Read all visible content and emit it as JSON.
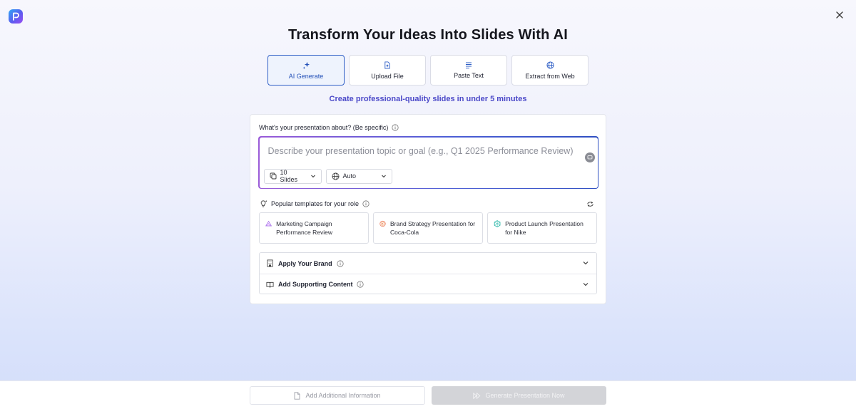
{
  "header": {
    "title": "Transform Your Ideas Into Slides With AI"
  },
  "tabs": [
    {
      "label": "AI Generate",
      "icon": "sparkle-icon",
      "active": true
    },
    {
      "label": "Upload File",
      "icon": "file-upload-icon",
      "active": false
    },
    {
      "label": "Paste Text",
      "icon": "text-lines-icon",
      "active": false
    },
    {
      "label": "Extract from Web",
      "icon": "globe-icon",
      "active": false
    }
  ],
  "tagline": "Create professional-quality slides in under 5 minutes",
  "prompt": {
    "label": "What's your presentation about? (Be specific)",
    "placeholder": "Describe your presentation topic or goal (e.g., Q1 2025 Performance Review)",
    "value": "",
    "slides_select": "10 Slides",
    "language_select": "Auto"
  },
  "templates": {
    "header": "Popular templates for your role",
    "items": [
      {
        "label": "Marketing Campaign Performance Review",
        "icon": "triangle-mountain-icon",
        "color": "#9b5de5"
      },
      {
        "label": "Brand Strategy Presentation for Coca-Cola",
        "icon": "target-icon",
        "color": "#e76f51"
      },
      {
        "label": "Product Launch Presentation for Nike",
        "icon": "hexagon-icon",
        "color": "#2ab7a9"
      }
    ]
  },
  "accordion": {
    "brand": "Apply Your Brand",
    "supporting": "Add Supporting Content"
  },
  "footer": {
    "add_info": "Add Additional Information",
    "generate": "Generate Presentation Now"
  },
  "colors": {
    "accent": "#2f5fc6",
    "tagline": "#4b49c8",
    "disabled": "#d3d4d8"
  }
}
